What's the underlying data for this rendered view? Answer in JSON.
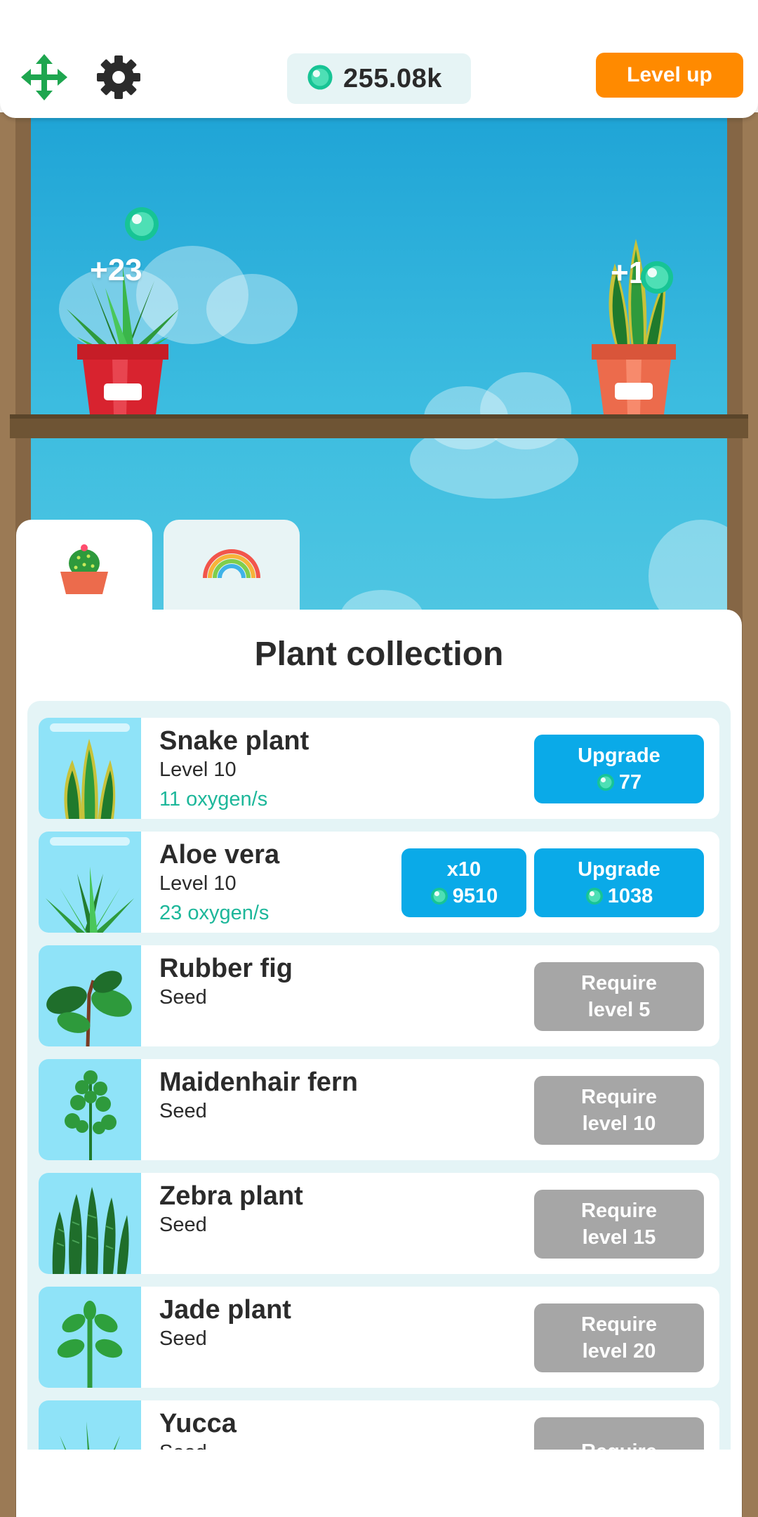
{
  "header": {
    "oxygen_total": "255.08k",
    "level_up_label": "Level up"
  },
  "scene": {
    "left_pot_gain": "+23",
    "right_pot_gain": "+1"
  },
  "tabs": [
    {
      "name": "plants-tab",
      "icon": "cactus-pot-icon"
    },
    {
      "name": "rainbow-tab",
      "icon": "rainbow-icon"
    }
  ],
  "panel": {
    "title": "Plant collection"
  },
  "plants": [
    {
      "name": "Snake plant",
      "level": "Level 10",
      "rate": "11 oxygen/s",
      "upgrade_label": "Upgrade",
      "upgrade_cost": "77"
    },
    {
      "name": "Aloe vera",
      "level": "Level 10",
      "rate": "23 oxygen/s",
      "x10_label": "x10",
      "x10_cost": "9510",
      "upgrade_label": "Upgrade",
      "upgrade_cost": "1038"
    },
    {
      "name": "Rubber fig",
      "level": "Seed",
      "req_line1": "Require",
      "req_line2": "level 5"
    },
    {
      "name": "Maidenhair fern",
      "level": "Seed",
      "req_line1": "Require",
      "req_line2": "level 10"
    },
    {
      "name": "Zebra plant",
      "level": "Seed",
      "req_line1": "Require",
      "req_line2": "level 15"
    },
    {
      "name": "Jade plant",
      "level": "Seed",
      "req_line1": "Require",
      "req_line2": "level 20"
    },
    {
      "name": "Yucca",
      "level": "Seed",
      "req_line1": "Require",
      "req_line2": ""
    }
  ],
  "colors": {
    "accent_orange": "#ff8a00",
    "upgrade_blue": "#0aaae8",
    "locked_gray": "#a6a6a6",
    "oxygen_green": "#1db79a"
  }
}
